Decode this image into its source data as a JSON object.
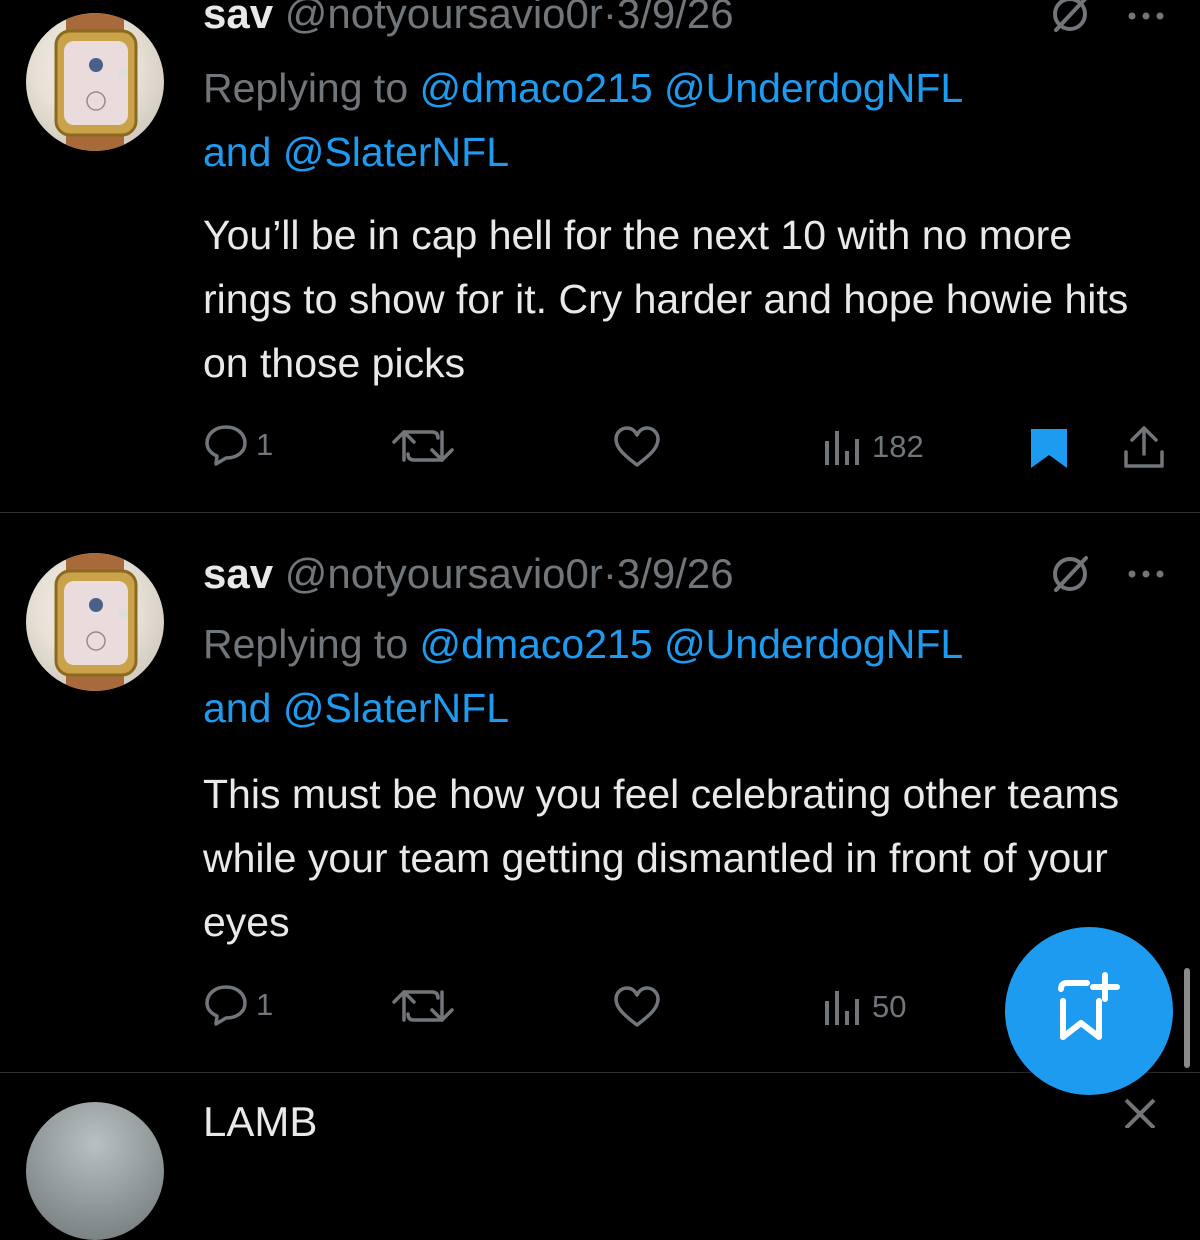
{
  "tweets": [
    {
      "name": "sav",
      "handle": "@notyoursavio0r",
      "sep": "·",
      "date": "3/9/26",
      "replying_prefix": "Replying to",
      "mention1": "@dmaco215",
      "mention2": "@UnderdogNFL",
      "and_word": "and",
      "mention3": "@SlaterNFL",
      "text": "You’ll be in cap hell for the next 10 with no more rings to show for it. Cry harder and hope howie hits on those picks",
      "replies": "1",
      "reposts": "",
      "likes": "",
      "views": "182",
      "bookmarked": true
    },
    {
      "name": "sav",
      "handle": "@notyoursavio0r",
      "sep": "·",
      "date": "3/9/26",
      "replying_prefix": "Replying to",
      "mention1": "@dmaco215",
      "mention2": "@UnderdogNFL",
      "and_word": "and",
      "mention3": "@SlaterNFL",
      "text": "This must be how you feel celebrating other teams while your team getting dismantled in front of your eyes",
      "replies": "1",
      "reposts": "",
      "likes": "",
      "views": "50",
      "bookmarked": false
    }
  ],
  "next_tweet_peek": {
    "text": "LAMB"
  },
  "colors": {
    "accent": "#1d9bf0",
    "muted": "#71767b",
    "text": "#e7e9ea",
    "background": "#000000"
  },
  "icons": [
    "reply-icon",
    "repost-icon",
    "like-icon",
    "views-icon",
    "bookmark-icon",
    "share-icon",
    "grok-icon",
    "more-icon",
    "compose-icon"
  ]
}
